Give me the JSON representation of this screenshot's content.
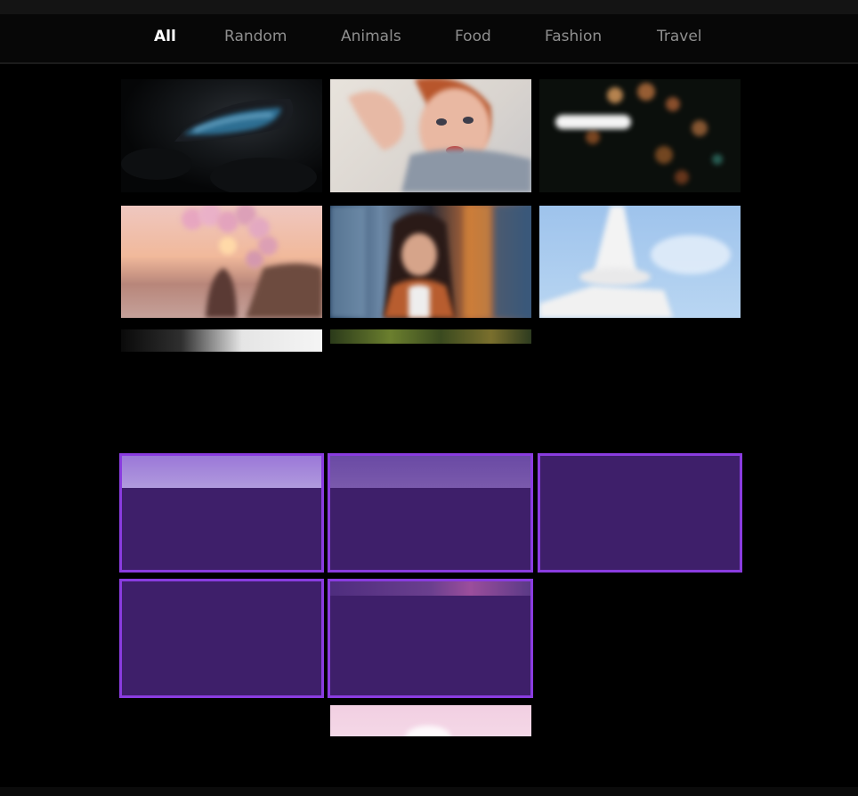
{
  "nav": {
    "items": [
      {
        "label": "All",
        "active": true
      },
      {
        "label": "Random",
        "active": false
      },
      {
        "label": "Animals",
        "active": false
      },
      {
        "label": "Food",
        "active": false
      },
      {
        "label": "Fashion",
        "active": false
      },
      {
        "label": "Travel",
        "active": false
      }
    ]
  },
  "colors": {
    "page_background": "#000000",
    "nav_background": "#070707",
    "nav_active": "#ffffff",
    "nav_inactive": "#8f8f8f",
    "placeholder_fill": "#3e1f6a",
    "placeholder_border": "#8a3ce0"
  },
  "gallery": {
    "loaded_images": [
      {
        "subject": "car-interior-photo"
      },
      {
        "subject": "woman-portrait-photo"
      },
      {
        "subject": "city-bokeh-lights-photo"
      },
      {
        "subject": "balloons-sunset-photo"
      },
      {
        "subject": "girl-with-fabrics-photo"
      },
      {
        "subject": "white-tower-sky-photo"
      },
      {
        "subject": "partial-grey-photo"
      },
      {
        "subject": "partial-green-photo"
      }
    ],
    "placeholders": 5,
    "partial_bottom_image": "pink-flower-photo"
  }
}
